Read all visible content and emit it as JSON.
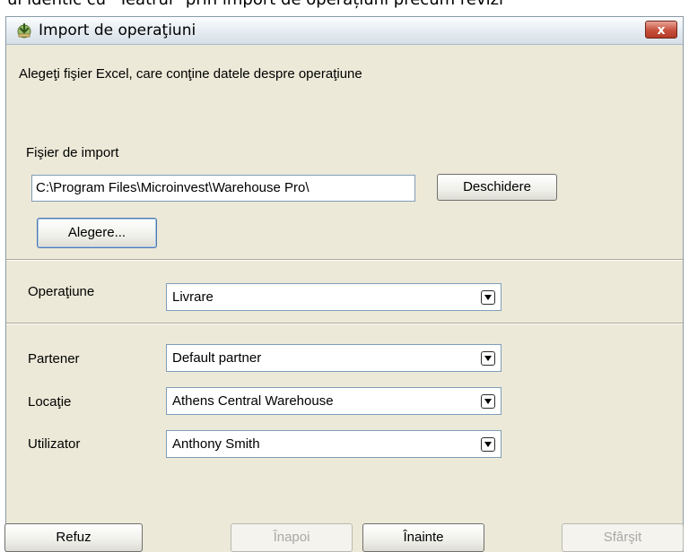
{
  "background_text": "ui identic cu \"Teatrul\" prin import de operațiuni precum revizi",
  "window": {
    "title": "Import de operaţiuni",
    "close_label": "x"
  },
  "instruction": "Alegeţi fişier Excel, care conţine datele despre operaţiune",
  "import_file": {
    "label": "Fişier de import",
    "path_value": "C:\\Program Files\\Microinvest\\Warehouse Pro\\",
    "open_button": "Deschidere",
    "choose_button": "Alegere..."
  },
  "operation": {
    "label": "Operaţiune",
    "value": "Livrare"
  },
  "fields": {
    "partner": {
      "label": "Partener",
      "value": "Default partner"
    },
    "location": {
      "label": "Locaţie",
      "value": "Athens Central Warehouse"
    },
    "user": {
      "label": "Utilizator",
      "value": "Anthony Smith"
    }
  },
  "buttons": {
    "cancel": "Refuz",
    "back": "Înapoi",
    "next": "Înainte",
    "finish": "Sfârşit"
  }
}
